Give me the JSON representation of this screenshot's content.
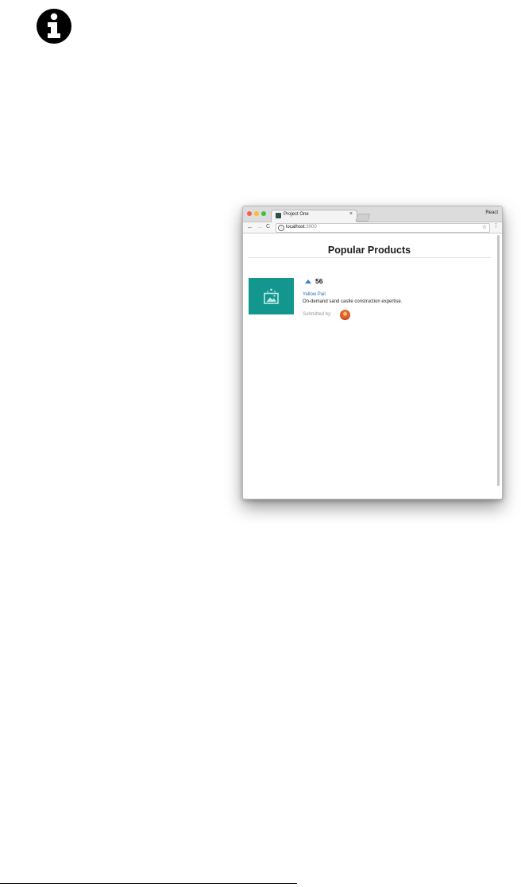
{
  "browser": {
    "tab_title": "Project One",
    "tab_close": "×",
    "profile_label": "React",
    "address": {
      "host": "localhost",
      "port": ":3000"
    },
    "nav": {
      "back": "←",
      "forward": "→",
      "reload": "C"
    },
    "bookmark_star": "☆",
    "menu": "⋮",
    "info_glyph": "i"
  },
  "page": {
    "heading": "Popular Products",
    "products": [
      {
        "votes": "56",
        "title": "Yellow Pail",
        "description": "On-demand sand castle construction expertise.",
        "submitted_label": "Submitted by:",
        "thumbnail_icon": "image-icon",
        "thumbnail_color": "#12968e"
      }
    ]
  },
  "colors": {
    "accent_link": "#2f6db3",
    "vote_arrow": "#3b7fc4"
  },
  "icons": {
    "page_info": "info-circle-icon",
    "upvote": "triangle-up-icon",
    "avatar": "user-avatar"
  }
}
